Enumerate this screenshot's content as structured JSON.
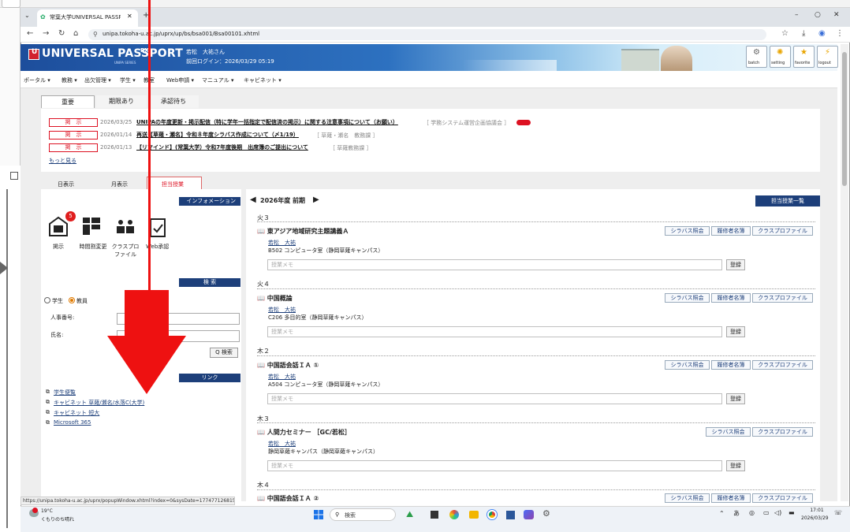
{
  "browser": {
    "tab_title": "常葉大学UNIVERSAL PASSPORT",
    "url": "unipa.tokoha-u.ac.jp/uprx/up/bs/bsa001/Bsa00101.xhtml",
    "status_url": "https://unipa.tokoha-u.ac.jp/uprx/popupWindow.xhtml?index=0&sysDate=1774771268158"
  },
  "header": {
    "logo": "UNIVERSAL PASSPORT",
    "logo_rx": "RX",
    "logo_sub": "UNIPA SERIES",
    "user_name": "若松　大祐さん",
    "last_login": "前回ログイン：2026/03/29 05:19",
    "buttons": [
      "batch",
      "setting",
      "favorite",
      "logout"
    ]
  },
  "menu": [
    "ポータル ▾",
    "教務 ▾",
    "出欠管理 ▾",
    "学生 ▾",
    "教室",
    "Web申請 ▾",
    "マニュアル ▾",
    "キャビネット ▾"
  ],
  "notice_tabs": [
    "重要",
    "期限あり",
    "承認待ち"
  ],
  "notices": [
    {
      "badge": "掲　示",
      "date": "2026/03/25",
      "title": "UNIPAの年度更新・掲示配信（特に学年一括指定で配信済の掲示）に関する注意事項について（お願い）",
      "source": "［ 学務システム運営企画協議会 ］"
    },
    {
      "badge": "掲　示",
      "date": "2026/01/14",
      "title": "再送【草薙・瀬名】令和８年度シラバス作成について（〆1/19）",
      "source": "［ 草薙・瀬名　教務課 ］"
    },
    {
      "badge": "掲　示",
      "date": "2026/01/13",
      "title": "【リマインド】(常葉大学）令和7年度後期　出席簿のご提出について",
      "source": "［ 草薙教務課 ］"
    }
  ],
  "more": "もっと見る",
  "view_tabs": [
    "日表示",
    "月表示",
    "担当授業"
  ],
  "info": {
    "header": "インフォメーション",
    "badge": "5",
    "items": [
      "掲示",
      "時間割変更",
      "クラスプロファイル",
      "Web承認"
    ]
  },
  "search": {
    "header": "検 索",
    "student": "学生",
    "teacher": "教員",
    "staff_no": "人事番号:",
    "name": "氏名:",
    "button": "Q 検索"
  },
  "links": {
    "header": "リンク",
    "items": [
      "学生便覧",
      "キャビネット 草薙/瀬名/水落C(大学)",
      "キャビネット 短大",
      "Microsoft 365"
    ]
  },
  "schedule": {
    "period": "2026年度 前期",
    "list_button": "担当授業一覧",
    "buttons": {
      "syllabus": "シラバス照会",
      "roster": "履修者名簿",
      "profile": "クラスプロファイル"
    },
    "memo_placeholder": "授業メモ",
    "register": "登録",
    "courses": [
      {
        "slot": "火３",
        "name": "東アジア地域研究主題講義Ａ",
        "teacher": "若松　大祐",
        "room": "B502 コンピュータ室（静岡草薙キャンパス）"
      },
      {
        "slot": "火４",
        "name": "中国概論",
        "teacher": "若松　大祐",
        "room": "C206 多目的室（静岡草薙キャンパス）"
      },
      {
        "slot": "木２",
        "name": "中国語会話ＩＡ ①",
        "teacher": "若松　大祐",
        "room": "A504 コンピュータ室（静岡草薙キャンパス）"
      },
      {
        "slot": "木３",
        "name": "人間力セミナー ［GC/若松］",
        "teacher": "若松　大祐",
        "room": "静岡草薙キャンパス（静岡草薙キャンパス）"
      },
      {
        "slot": "木４",
        "name": "中国語会話ＩＡ ②",
        "teacher": "",
        "room": ""
      }
    ]
  },
  "taskbar": {
    "temp": "19°C",
    "weather": "くもりのち晴れ",
    "search": "検索",
    "ime": "あ",
    "time": "17:01",
    "date": "2026/03/29"
  },
  "colors": {
    "navy": "#1d3f7a",
    "badge_red": "#d12222",
    "arrow_red": "#e11"
  }
}
